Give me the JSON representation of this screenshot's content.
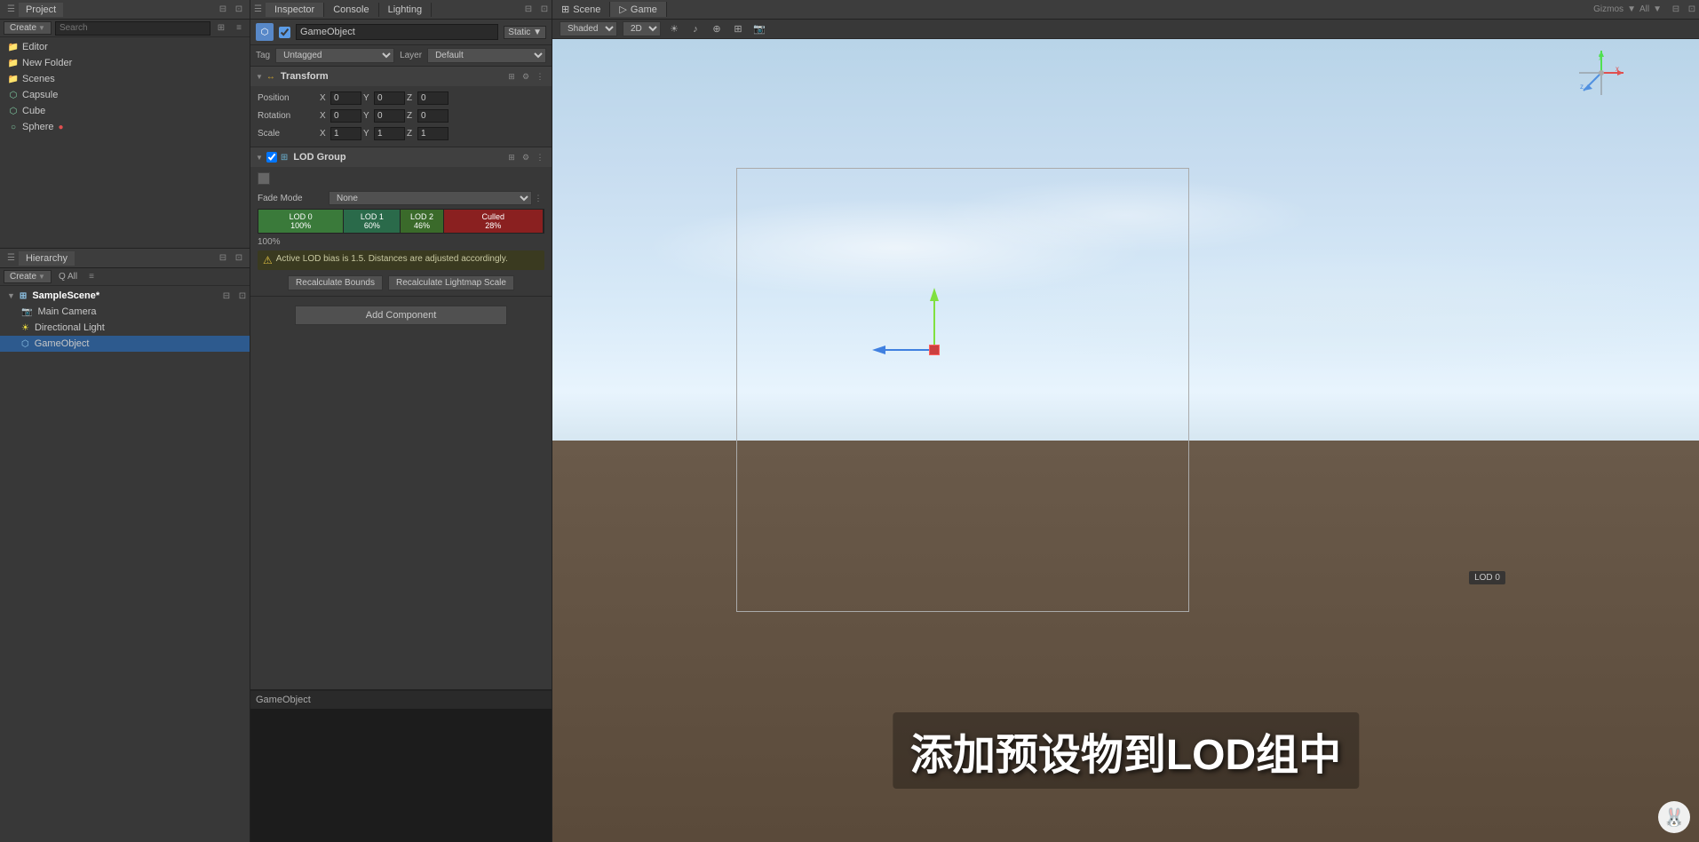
{
  "project_panel": {
    "title": "Project",
    "tabs": [
      "Project"
    ],
    "create_label": "Create",
    "search_placeholder": "Search",
    "tree": [
      {
        "label": "Editor",
        "type": "folder",
        "indent": 0
      },
      {
        "label": "New Folder",
        "type": "folder",
        "indent": 0
      },
      {
        "label": "Scenes",
        "type": "folder",
        "indent": 0
      },
      {
        "label": "Capsule",
        "type": "mesh",
        "indent": 0
      },
      {
        "label": "Cube",
        "type": "mesh",
        "indent": 0
      },
      {
        "label": "Sphere",
        "type": "mesh",
        "indent": 0
      }
    ]
  },
  "hierarchy_panel": {
    "title": "Hierarchy",
    "create_label": "Create",
    "search_placeholder": "Q All",
    "items": [
      {
        "label": "SampleScene*",
        "type": "scene",
        "indent": 0
      },
      {
        "label": "Main Camera",
        "type": "camera",
        "indent": 1
      },
      {
        "label": "Directional Light",
        "type": "light",
        "indent": 1
      },
      {
        "label": "GameObject",
        "type": "gameobject",
        "indent": 1,
        "selected": true
      }
    ]
  },
  "inspector_panel": {
    "title": "Inspector",
    "tabs": [
      "Inspector",
      "Console",
      "Lighting"
    ],
    "gameobject": {
      "name": "GameObject",
      "active": true,
      "tag": "Untagged",
      "layer": "Default",
      "static_label": "Static"
    },
    "transform": {
      "label": "Transform",
      "position": {
        "x": "0",
        "y": "0",
        "z": "0"
      },
      "rotation": {
        "x": "0",
        "y": "0",
        "z": "0"
      },
      "scale": {
        "x": "1",
        "y": "1",
        "z": "1"
      }
    },
    "lod_group": {
      "label": "LOD Group",
      "fade_mode_label": "Fade Mode",
      "fade_mode_value": "None",
      "segments": [
        {
          "label": "LOD 0",
          "percent": "100%",
          "class": "lod0"
        },
        {
          "label": "LOD 1",
          "percent": "60%",
          "class": "lod1"
        },
        {
          "label": "LOD 2",
          "percent": "46%",
          "class": "lod2"
        },
        {
          "label": "Culled",
          "percent": "28%",
          "class": "culled"
        }
      ],
      "current_percent": "100%",
      "warning_text": "Active LOD bias is 1.5. Distances are adjusted accordingly.",
      "recalculate_bounds_label": "Recalculate Bounds",
      "recalculate_lightmap_label": "Recalculate Lightmap Scale"
    },
    "add_component_label": "Add Component",
    "preview_label": "GameObject"
  },
  "scene_view": {
    "tabs": [
      {
        "label": "Scene",
        "icon": "⊞",
        "active": false
      },
      {
        "label": "Game",
        "icon": "▷",
        "active": true
      }
    ],
    "toolbar": {
      "shading_mode": "Shaded",
      "dimension": "2D",
      "gizmos_label": "Gizmos",
      "all_label": "All"
    },
    "overlay_text": "添加预设物到LOD组中",
    "lod_popup": "LOD 0",
    "gizmo_compass": {
      "labels": [
        "x",
        "y",
        "z"
      ]
    }
  },
  "colors": {
    "accent_blue": "#2d5a8e",
    "lod0_green": "#3a7a3a",
    "lod1_teal": "#2a6a4a",
    "lod2_green": "#3a6a2a",
    "culled_red": "#8a2020",
    "warning_yellow": "#e0c040"
  }
}
